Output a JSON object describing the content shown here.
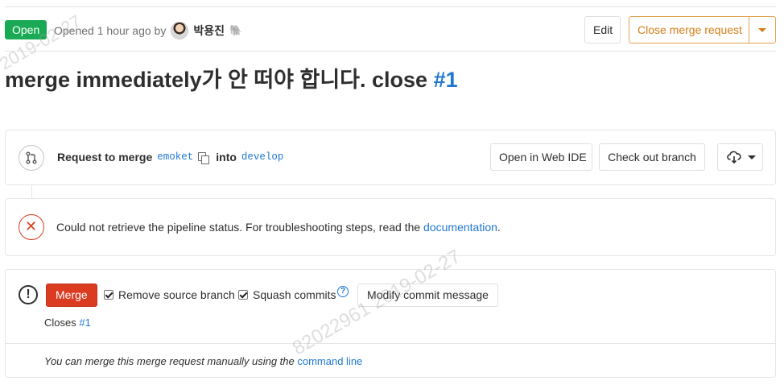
{
  "header": {
    "status_badge": "Open",
    "opened_text": "Opened 1 hour ago by",
    "author_name": "박용진",
    "edit_label": "Edit",
    "close_label": "Close merge request"
  },
  "title": {
    "text": "merge immediately가 안 떠야 합니다. close",
    "ref": "#1"
  },
  "merge_info": {
    "request_label": "Request to merge",
    "source_branch": "emoket",
    "into_label": "into",
    "target_branch": "develop",
    "open_ide_label": "Open in Web IDE",
    "checkout_label": "Check out branch"
  },
  "pipeline": {
    "message": "Could not retrieve the pipeline status. For troubleshooting steps, read the",
    "link_text": "documentation",
    "suffix": "."
  },
  "merge_widget": {
    "merge_label": "Merge",
    "remove_source_label": "Remove source branch",
    "remove_source_checked": true,
    "squash_label": "Squash commits",
    "squash_checked": true,
    "modify_label": "Modify commit message",
    "closes_label": "Closes",
    "closes_ref": "#1",
    "footer_text": "You can merge this merge request manually using the",
    "footer_link": "command line"
  },
  "watermarks": {
    "top_left": "2019-02-27",
    "middle": "82022961 2019-02-27"
  },
  "colors": {
    "open_green": "#1aaa55",
    "close_orange": "#d57d18",
    "merge_red": "#db3b21",
    "link_blue": "#1f78d1"
  },
  "icons": [
    "merge-request-icon",
    "copy-icon",
    "download-cloud-icon",
    "error-x-icon",
    "warning-exclamation-icon",
    "help-question-icon",
    "emoji-icon"
  ]
}
